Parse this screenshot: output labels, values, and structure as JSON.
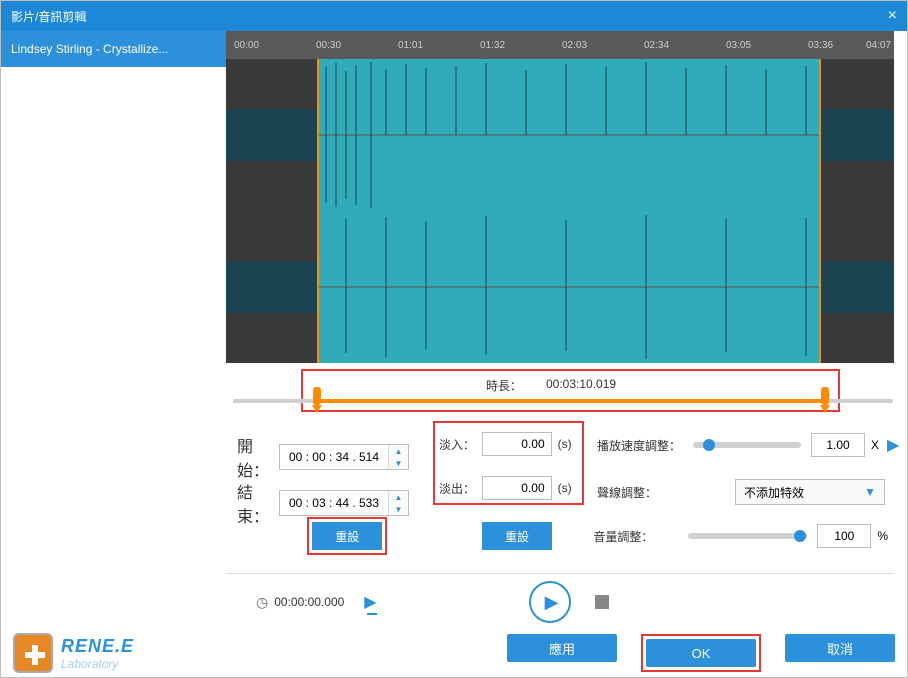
{
  "window": {
    "title": "影片/音訊剪輯"
  },
  "sidebar": {
    "file_name": "Lindsey Stirling - Crystallize..."
  },
  "timeline": {
    "ticks": [
      "00:00",
      "00:30",
      "01:01",
      "01:32",
      "02:03",
      "02:34",
      "03:05",
      "03:36",
      "04:07"
    ]
  },
  "duration": {
    "label": "時長：",
    "value": "00:03:10.019"
  },
  "time_controls": {
    "start_label": "開始：",
    "start_value": "00 : 00 : 34 . 514",
    "end_label": "結束：",
    "end_value": "00 : 03 : 44 . 533",
    "reset_label": "重設"
  },
  "fade": {
    "in_label": "淡入：",
    "in_value": "0.00",
    "out_label": "淡出：",
    "out_value": "0.00",
    "unit": "(s)",
    "reset_label": "重設"
  },
  "speed": {
    "label": "播放速度調整：",
    "value": "1.00",
    "unit": "X"
  },
  "sfx": {
    "label": "聲線調整：",
    "selected": "不添加特效"
  },
  "volume": {
    "label": "音量調整：",
    "value": "100",
    "unit": "%"
  },
  "transport": {
    "current_time": "00:00:00.000"
  },
  "footer": {
    "logo_top": "RENE.E",
    "logo_bottom": "Laboratory",
    "apply": "應用",
    "ok": "OK",
    "cancel": "取消"
  }
}
